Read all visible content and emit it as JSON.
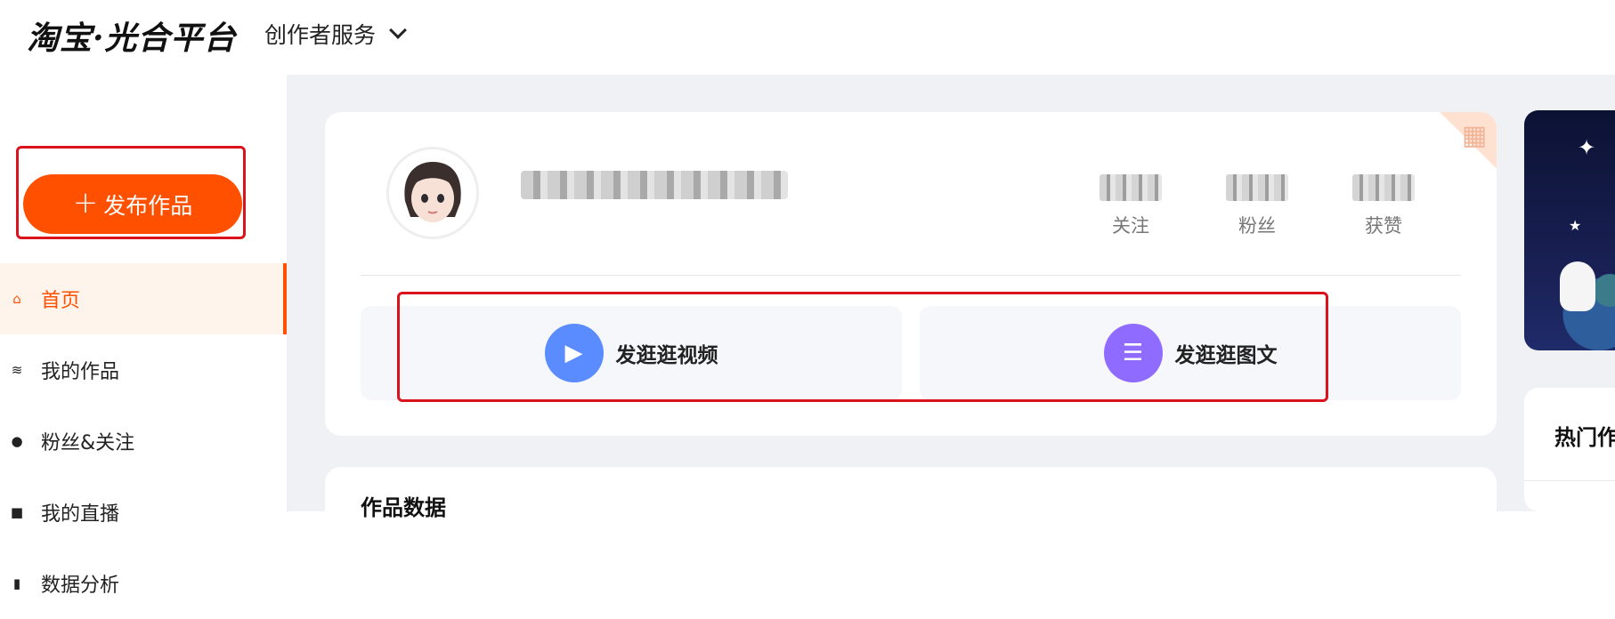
{
  "header": {
    "logo": "淘宝·光合平台",
    "service_menu": "创作者服务"
  },
  "sidebar": {
    "publish_label": "发布作品",
    "items": [
      {
        "label": "首页",
        "icon": "home-icon",
        "active": true
      },
      {
        "label": "我的作品",
        "icon": "layers-icon",
        "active": false
      },
      {
        "label": "粉丝&关注",
        "icon": "users-icon",
        "active": false
      },
      {
        "label": "我的直播",
        "icon": "video-camera-icon",
        "active": false
      },
      {
        "label": "数据分析",
        "icon": "bar-chart-icon",
        "active": false
      }
    ]
  },
  "profile": {
    "stats": [
      {
        "label": "关注"
      },
      {
        "label": "粉丝"
      },
      {
        "label": "获赞"
      }
    ]
  },
  "actions": [
    {
      "label": "发逛逛视频",
      "icon": "video-icon",
      "color": "#5b8cff"
    },
    {
      "label": "发逛逛图文",
      "icon": "image-text-icon",
      "color": "#8f6bff"
    }
  ],
  "sections": {
    "works_data_title": "作品数据",
    "hot_title": "热门作"
  },
  "colors": {
    "accent": "#ff5000",
    "highlight": "#d9121b",
    "background": "#f0f1f5"
  }
}
